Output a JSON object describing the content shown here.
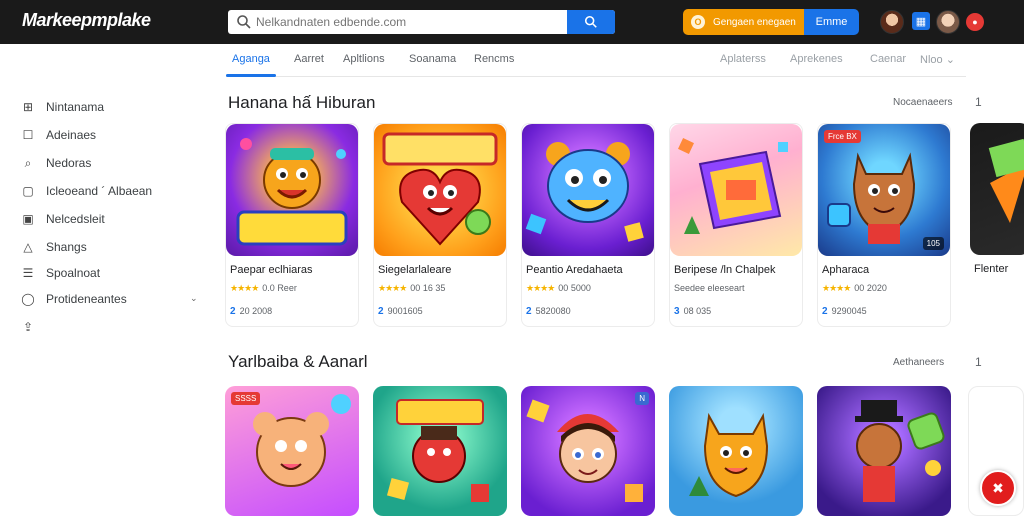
{
  "header": {
    "logo": "Markeepmplake",
    "search_placeholder": "Nelkandnaten edbende.com",
    "cta_label": "Gengaen enegaen",
    "cta_icon": "O",
    "signin_label": "Emme",
    "apps_icon": "▦",
    "notif_icon": "●"
  },
  "tabs": {
    "left": [
      "Aganga",
      "Aarret",
      "Apltlions",
      "Soanama",
      "Rencms"
    ],
    "right": [
      "Aplaterss",
      "Aprekenes",
      "Caenar",
      "Nloo"
    ]
  },
  "sidebar": {
    "items": [
      {
        "label": "Nintanama",
        "icon": "⊞"
      },
      {
        "label": "Adeinaes",
        "icon": "☐"
      },
      {
        "label": "Nedoras",
        "icon": "⌕"
      },
      {
        "label": "Icleoeand ´ Albaean",
        "icon": "▢"
      },
      {
        "label": "Nelcedsleit",
        "icon": "▣"
      },
      {
        "label": "Shangs",
        "icon": "△"
      },
      {
        "label": "Spoalnoat",
        "icon": "☰"
      },
      {
        "label": "Protideneantes",
        "icon": "◯"
      },
      {
        "label": "",
        "icon": "⇪"
      }
    ]
  },
  "section1": {
    "title": "Hanana hấ Hiburan",
    "more": "Nocaenaeers",
    "arrow": "1",
    "cards": [
      {
        "name": "Paepar eclhiaras",
        "rating": "0.0",
        "sub": "Reer",
        "count_num": "2",
        "count": "20 2008"
      },
      {
        "name": "Siegelarlaleare",
        "rating": "00",
        "sub": "16 35",
        "count_num": "2",
        "count": "9001605"
      },
      {
        "name": "Peantio Aredahaeta",
        "rating": "00",
        "sub": "5000",
        "count_num": "2",
        "count": "5820080"
      },
      {
        "name": "Beripese /ln Chalpek",
        "rating": "",
        "sub": "Seedee eleeseart",
        "count_num": "3",
        "count": "08 035"
      },
      {
        "name": "Apharaca",
        "rating": "00",
        "sub": "2020",
        "count_num": "2",
        "count": "9290045"
      },
      {
        "name": "Flenter",
        "rating": "",
        "sub": "",
        "count_num": "",
        "count": ""
      }
    ]
  },
  "section2": {
    "title": "Yarlbaiba & Aanarl",
    "more": "Aethaneers",
    "arrow": "1"
  },
  "badges": {
    "card5_top": "Frce BX",
    "card5_bottom": "105",
    "s2_card1": "SSSS",
    "s2_card3": "N"
  },
  "fab_icon": "✖",
  "colors": {
    "accent": "#1a73e8",
    "cta": "#f29900",
    "topbar": "#1a1a1a",
    "star": "#f6b400"
  }
}
